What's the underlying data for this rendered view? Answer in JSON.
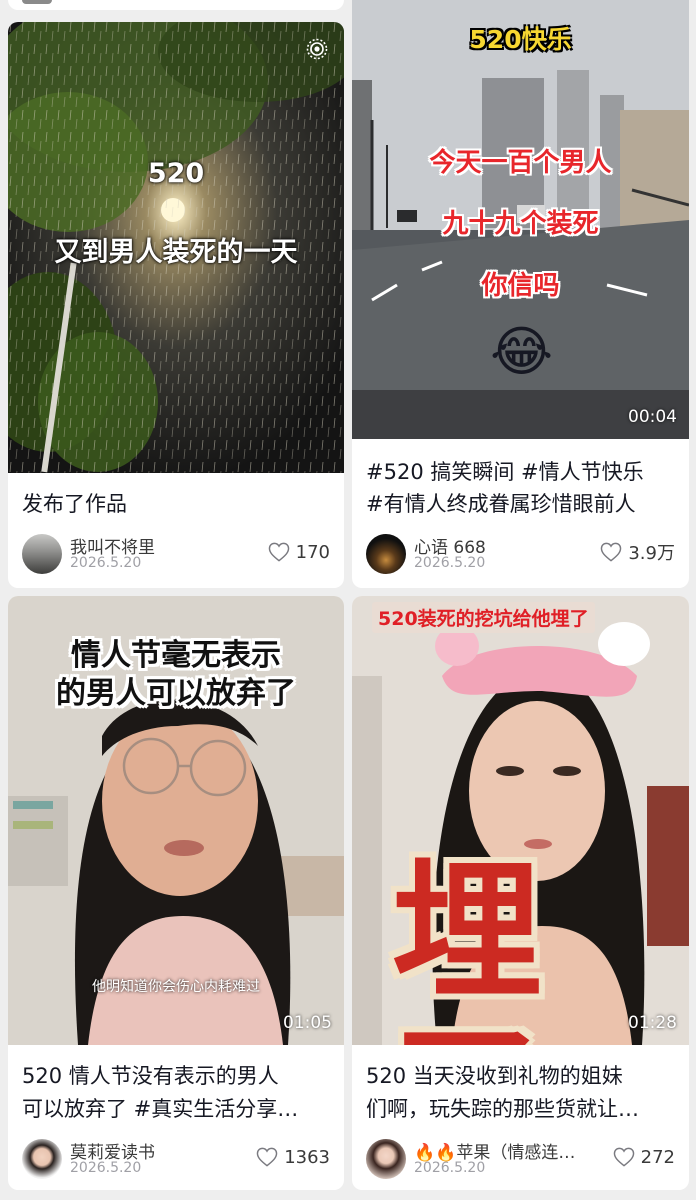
{
  "colors": {
    "background": "#eeeeee",
    "card": "#ffffff",
    "meta_text": "#a0a0a6",
    "caption_red": "#e8262b"
  },
  "cards": [
    {
      "cover_caption_line1": "520",
      "cover_caption_line2": "又到男人装死的一天",
      "cover_icon": "live-photo-icon",
      "title": "发布了作品",
      "author": "我叫不将里",
      "date": "2026.5.20",
      "likes": "170"
    },
    {
      "cover_caption_top": "520快乐",
      "cover_caption_line1": "今天一百个男人",
      "cover_caption_line2": "九十九个装死",
      "cover_caption_line3": "你信吗",
      "cover_emoji": "😂",
      "duration": "00:04",
      "title_line1": "#520 搞笑瞬间 #情人节快乐",
      "title_line2": "#有情人终成眷属珍惜眼前人",
      "author": "心语 668",
      "date": "2026.5.20",
      "likes": "3.9万"
    },
    {
      "cover_caption_line1": "情人节毫无表示",
      "cover_caption_line2": "的男人可以放弃了",
      "cover_subtitle": "他明知道你会伤心内耗难过",
      "duration": "01:05",
      "title_line1": "520 情人节没有表示的男人",
      "title_line2": "可以放弃了 #真实生活分享…",
      "author": "莫莉爱读书",
      "date": "2026.5.20",
      "likes": "1363"
    },
    {
      "cover_caption_top": "520装死的挖坑给他埋了",
      "cover_caption_big": "埋了",
      "duration": "01:28",
      "title_line1": "520 当天没收到礼物的姐妹",
      "title_line2": "们啊，玩失踪的那些货就让…",
      "author": "🔥🔥苹果（情感连…",
      "date": "2026.5.20",
      "likes": "272"
    }
  ]
}
